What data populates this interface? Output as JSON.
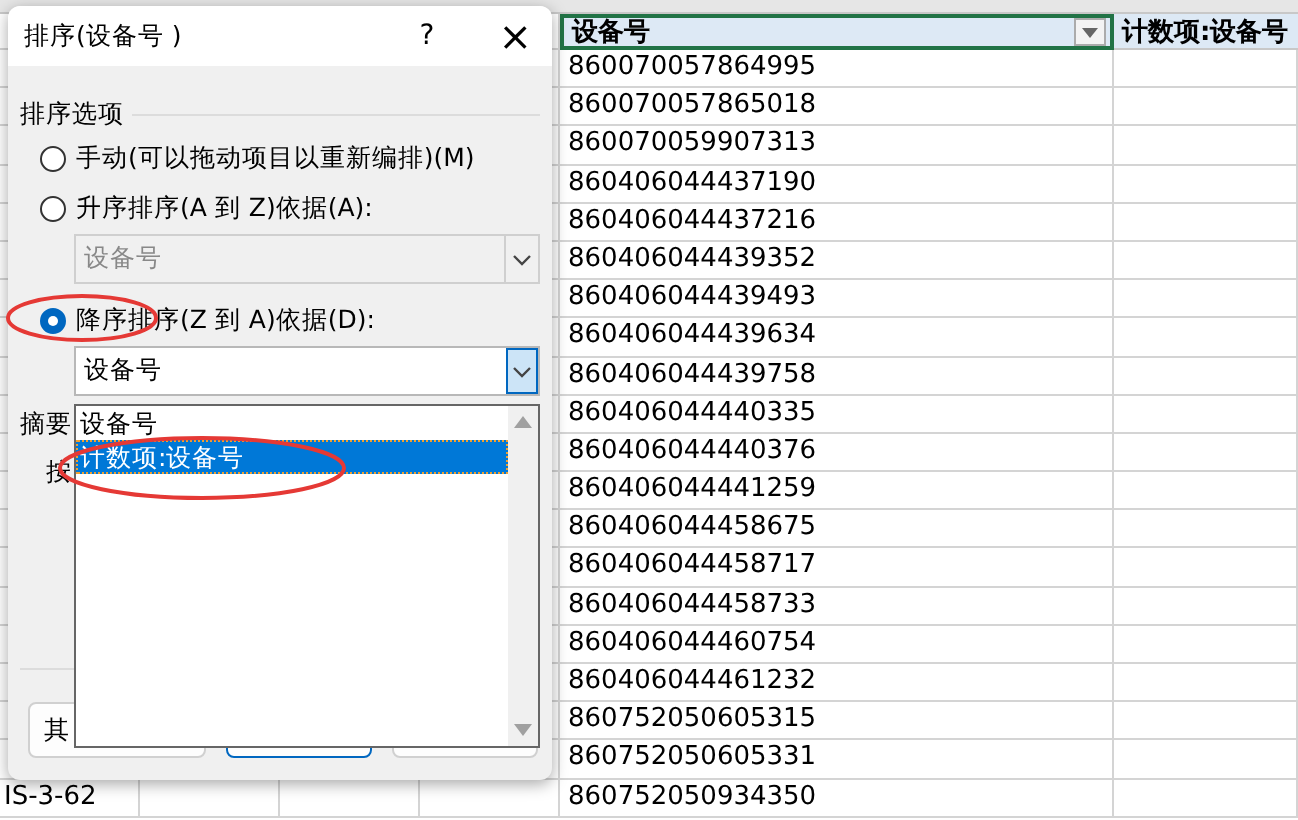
{
  "sheet": {
    "columns": [
      {
        "header": "设备号",
        "filter": true
      },
      {
        "header": "计数项:设备号",
        "filter": false
      }
    ],
    "rows": [
      "860070057864995",
      "860070057865018",
      "860070059907313",
      "860406044437190",
      "860406044437216",
      "860406044439352",
      "860406044439493",
      "860406044439634",
      "860406044439758",
      "860406044440335",
      "860406044440376",
      "860406044441259",
      "860406044458675",
      "860406044458717",
      "860406044458733",
      "860406044460754",
      "860406044461232",
      "860752050605315",
      "860752050605331",
      "860752050934350"
    ],
    "footer_cell": "IS-3-62"
  },
  "dialog": {
    "title": "排序(设备号 )",
    "help_button": "?",
    "close_button": "×",
    "group_label": "排序选项",
    "options": [
      {
        "label": "手动(可以拖动项目以重新编排)(M)",
        "selected": false
      },
      {
        "label": "升序排序(A 到 Z)依据(A):",
        "selected": false,
        "combo": {
          "value": "设备号",
          "disabled": true,
          "expanded": false
        }
      },
      {
        "label": "降序排序(Z 到 A)依据(D):",
        "selected": true,
        "combo": {
          "value": "设备号",
          "disabled": false,
          "expanded": true
        }
      }
    ],
    "dropdown_items": [
      {
        "label": "设备号",
        "selected": false
      },
      {
        "label": "计数项:设备号",
        "selected": true
      }
    ],
    "summary_label": "摘要",
    "by_label": "按",
    "other_button": "其"
  }
}
